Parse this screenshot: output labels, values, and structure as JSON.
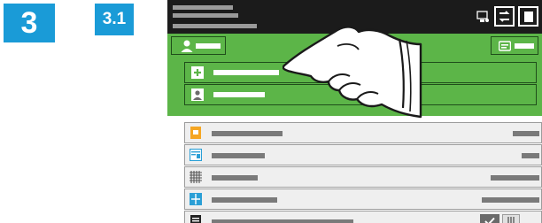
{
  "step": {
    "number": "3",
    "substep": "3.1"
  },
  "colors": {
    "step_badge": "#1a9bd7",
    "header_bg": "#1b1b1b",
    "accent_green": "#5cb548",
    "list_bg": "#efefef",
    "placeholder_gray": "#7a7a7a"
  },
  "header": {
    "icons": [
      "device-status-icon",
      "job-status-icon",
      "stop-icon"
    ]
  },
  "action_bar": {
    "left_icon": "user-icon",
    "right_icon": "card-icon"
  },
  "menu": {
    "items": [
      {
        "icon": "plus-icon"
      },
      {
        "icon": "contact-icon"
      }
    ]
  },
  "list": {
    "rows": [
      {
        "icon": "folder-icon",
        "color": "#f5a623"
      },
      {
        "icon": "form-icon",
        "color": "#2a9fd6"
      },
      {
        "icon": "grid-icon",
        "color": "#555555"
      },
      {
        "icon": "split-icon",
        "color": "#2a9fd6"
      },
      {
        "icon": "document-icon",
        "color": "#222222"
      }
    ]
  },
  "hand": {
    "icon": "pointing-hand-icon"
  }
}
